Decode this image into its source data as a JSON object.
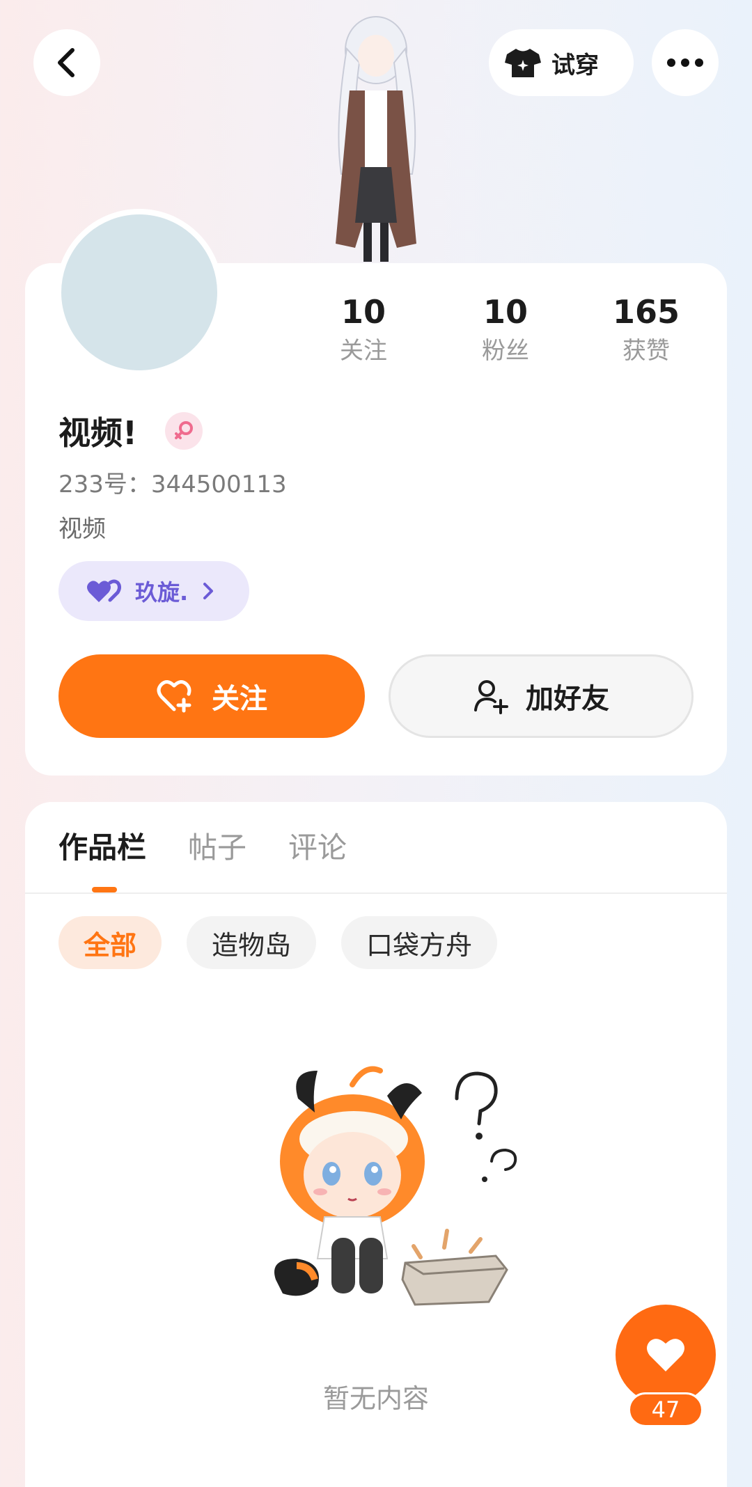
{
  "header": {
    "back_icon": "chevron-left-icon",
    "tryon_label": "试穿",
    "tryon_icon": "shirt-sparkle-icon",
    "more_icon": "more-dots-icon"
  },
  "profile": {
    "stats": [
      {
        "value": "10",
        "label": "关注"
      },
      {
        "value": "10",
        "label": "粉丝"
      },
      {
        "value": "165",
        "label": "获赞"
      }
    ],
    "name": "视频!",
    "gender_icon": "female-icon",
    "uid": "233号：344500113",
    "signature": "视频",
    "tag_label": "玖旋.",
    "follow_label": "关注",
    "add_friend_label": "加好友",
    "accent_color": "#ff7513"
  },
  "content": {
    "tabs": [
      "作品栏",
      "帖子",
      "评论"
    ],
    "active_tab": "作品栏",
    "chips": [
      "全部",
      "造物岛",
      "口袋方舟"
    ],
    "active_chip": "全部",
    "empty_text": "暂无内容"
  },
  "fab": {
    "icon": "heart-icon",
    "count": "47"
  }
}
